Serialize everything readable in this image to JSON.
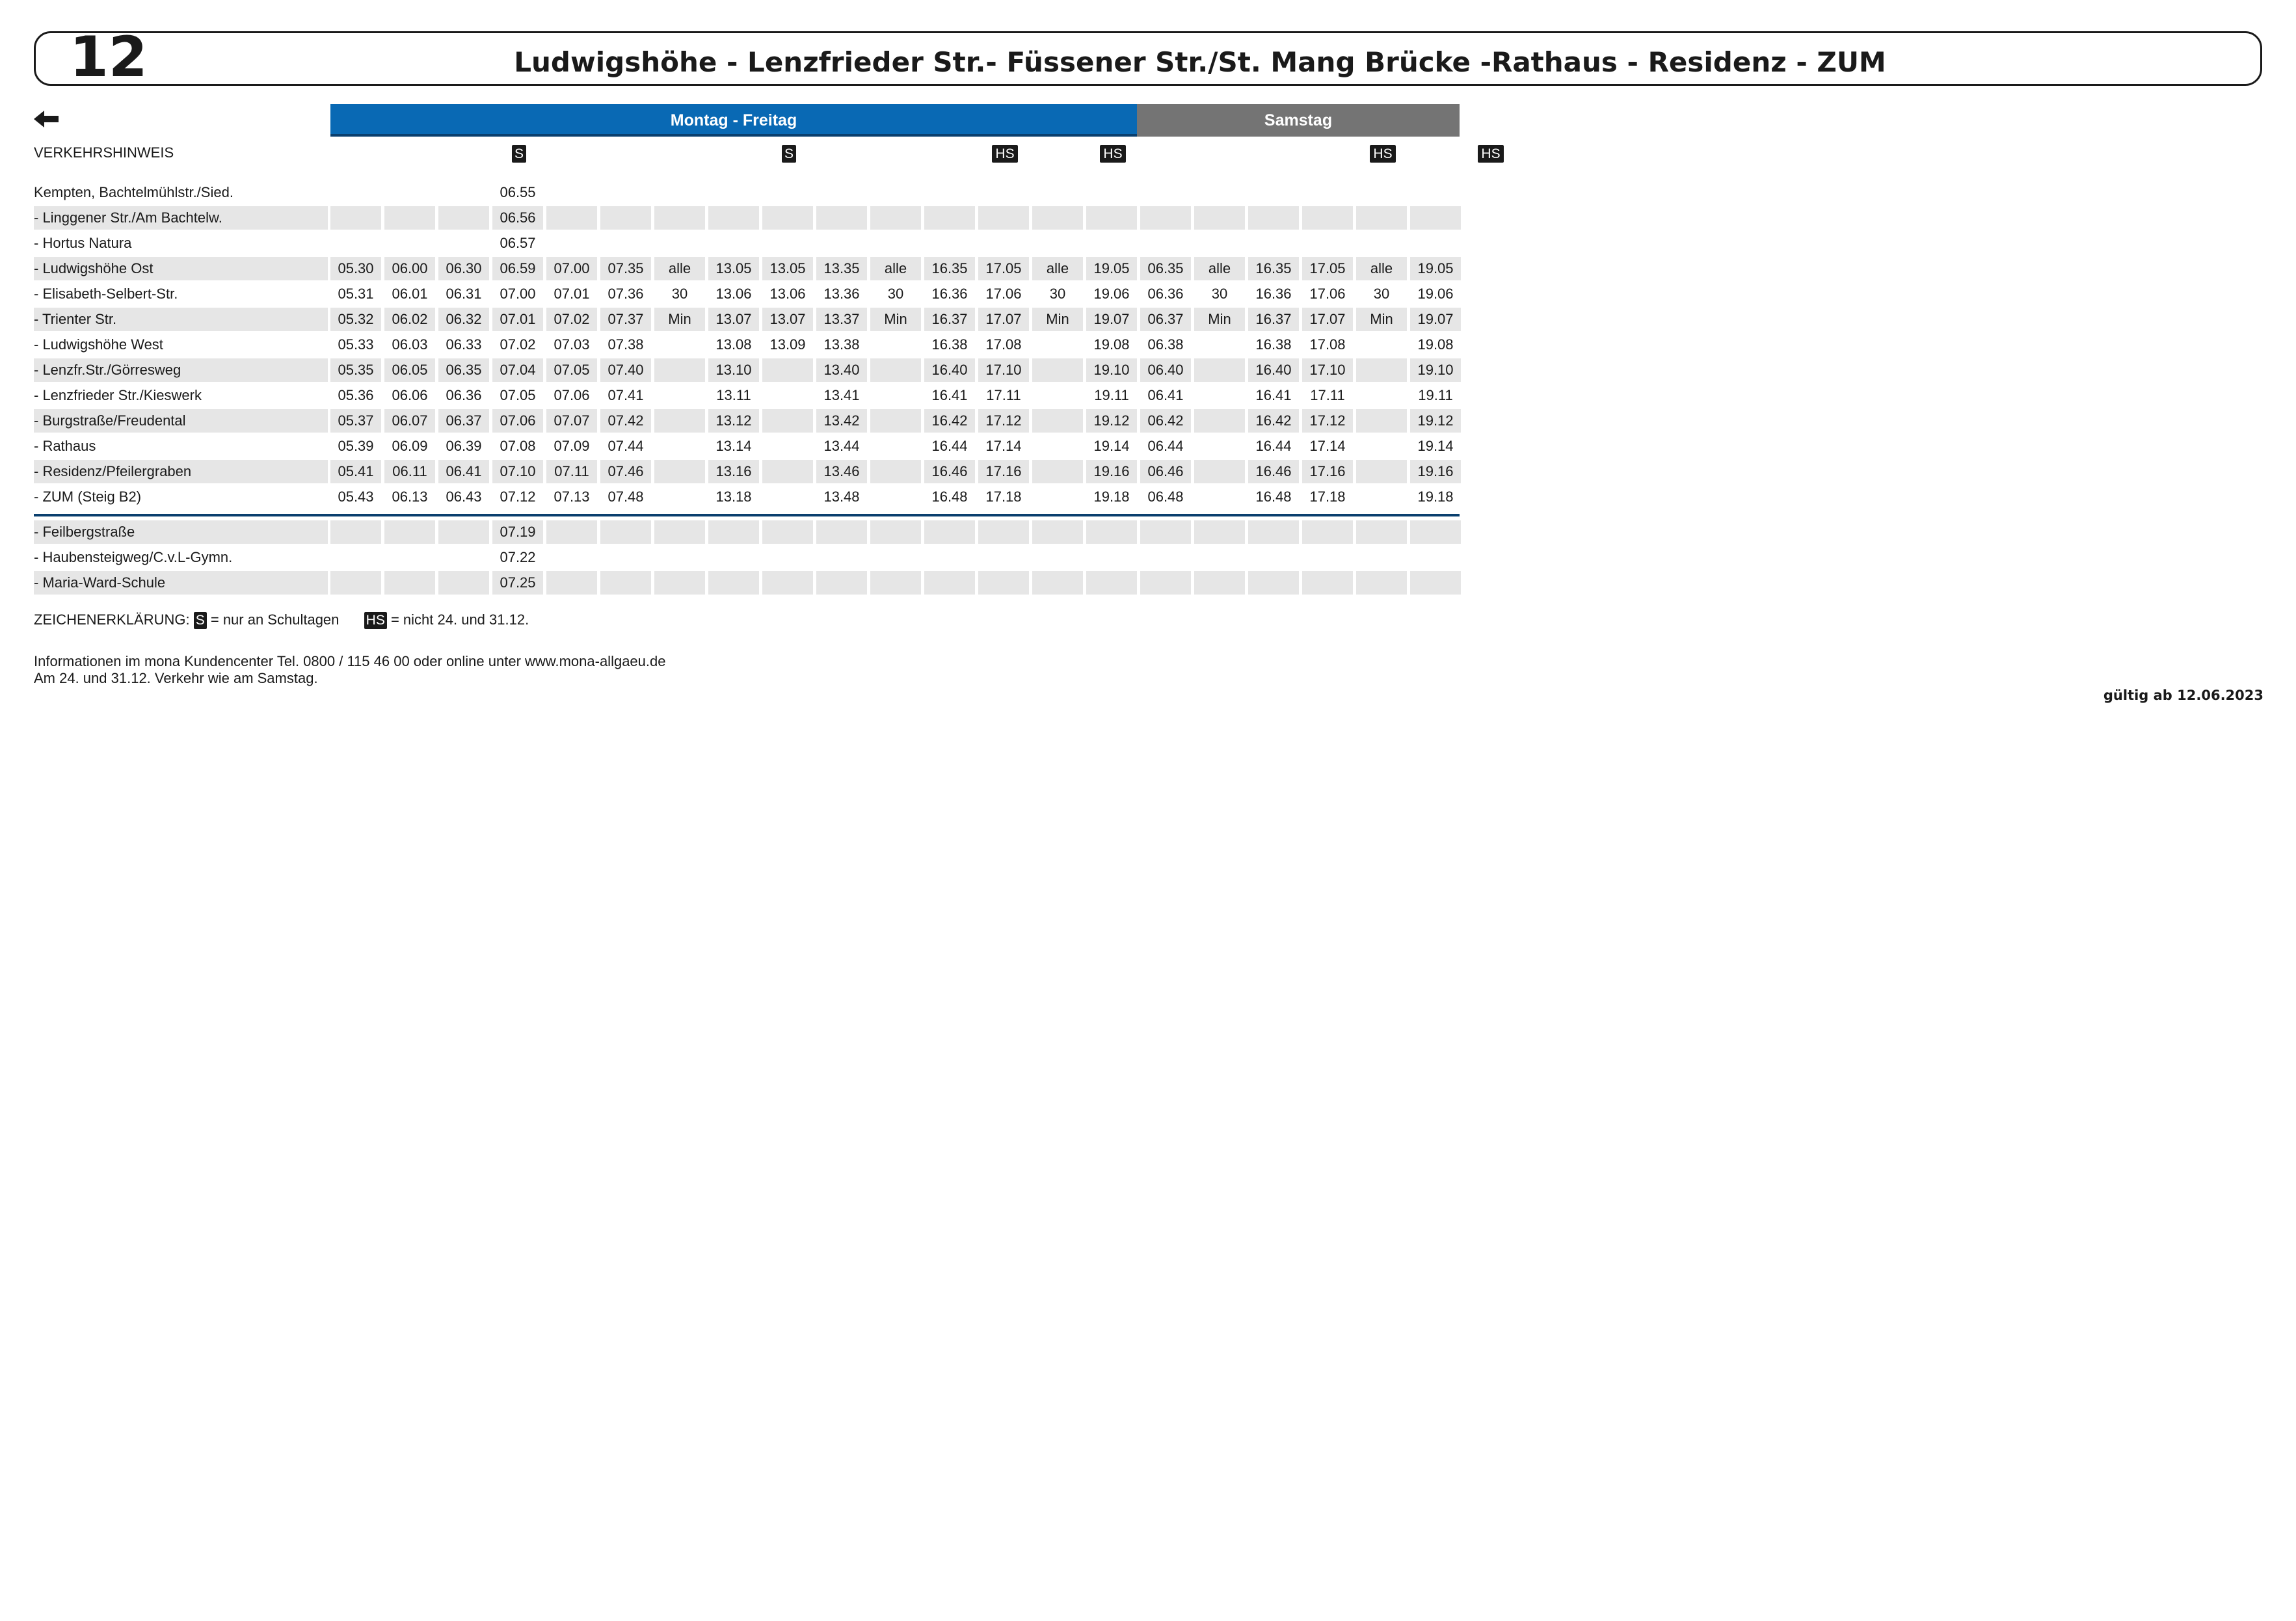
{
  "header": {
    "line_number": "12",
    "route_title": "Ludwigshöhe - Lenzfrieder Str.- Füssener Str./St. Mang Brücke -Rathaus  - Residenz - ZUM"
  },
  "direction_icon": "left-arrow-icon",
  "colors": {
    "weekday_bar": "#0969b4",
    "saturday_bar": "#747474",
    "row_shade": "#e6e6e6",
    "divider": "#0a3f6e"
  },
  "day_groups": {
    "weekday": "Montag - Freitag",
    "saturday": "Samstag"
  },
  "hint_label": "VERKEHRSHINWEIS",
  "hints": [
    "",
    "",
    "",
    "S",
    "",
    "",
    "",
    "",
    "S",
    "",
    "",
    "",
    "HS",
    "",
    "HS",
    "",
    "",
    "",
    "",
    "HS",
    "",
    "HS"
  ],
  "stops": [
    {
      "name": "Kempten, Bachtelmühlstr./Sied.",
      "times": [
        "",
        "",
        "",
        "06.55",
        "",
        "",
        "",
        "",
        "",
        "",
        "",
        "",
        "",
        "",
        "",
        "",
        "",
        "",
        "",
        "",
        "",
        ""
      ]
    },
    {
      "name": "- Linggener Str./Am Bachtelw.",
      "times": [
        "",
        "",
        "",
        "06.56",
        "",
        "",
        "",
        "",
        "",
        "",
        "",
        "",
        "",
        "",
        "",
        "",
        "",
        "",
        "",
        "",
        "",
        ""
      ]
    },
    {
      "name": "- Hortus Natura",
      "times": [
        "",
        "",
        "",
        "06.57",
        "",
        "",
        "",
        "",
        "",
        "",
        "",
        "",
        "",
        "",
        "",
        "",
        "",
        "",
        "",
        "",
        "",
        ""
      ]
    },
    {
      "name": "- Ludwigshöhe Ost",
      "times": [
        "05.30",
        "06.00",
        "06.30",
        "06.59",
        "07.00",
        "07.35",
        "alle",
        "13.05",
        "13.05",
        "13.35",
        "alle",
        "16.35",
        "17.05",
        "alle",
        "19.05",
        "06.35",
        "alle",
        "16.35",
        "17.05",
        "alle",
        "19.05",
        ""
      ]
    },
    {
      "name": "- Elisabeth-Selbert-Str.",
      "times": [
        "05.31",
        "06.01",
        "06.31",
        "07.00",
        "07.01",
        "07.36",
        "30",
        "13.06",
        "13.06",
        "13.36",
        "30",
        "16.36",
        "17.06",
        "30",
        "19.06",
        "06.36",
        "30",
        "16.36",
        "17.06",
        "30",
        "19.06",
        ""
      ]
    },
    {
      "name": "- Trienter Str.",
      "times": [
        "05.32",
        "06.02",
        "06.32",
        "07.01",
        "07.02",
        "07.37",
        "Min",
        "13.07",
        "13.07",
        "13.37",
        "Min",
        "16.37",
        "17.07",
        "Min",
        "19.07",
        "06.37",
        "Min",
        "16.37",
        "17.07",
        "Min",
        "19.07",
        ""
      ]
    },
    {
      "name": "- Ludwigshöhe West",
      "times": [
        "05.33",
        "06.03",
        "06.33",
        "07.02",
        "07.03",
        "07.38",
        "",
        "13.08",
        "13.09",
        "13.38",
        "",
        "16.38",
        "17.08",
        "",
        "19.08",
        "06.38",
        "",
        "16.38",
        "17.08",
        "",
        "19.08",
        ""
      ]
    },
    {
      "name": "- Lenzfr.Str./Görresweg",
      "times": [
        "05.35",
        "06.05",
        "06.35",
        "07.04",
        "07.05",
        "07.40",
        "",
        "13.10",
        "",
        "13.40",
        "",
        "16.40",
        "17.10",
        "",
        "19.10",
        "06.40",
        "",
        "16.40",
        "17.10",
        "",
        "19.10",
        ""
      ]
    },
    {
      "name": "- Lenzfrieder Str./Kieswerk",
      "times": [
        "05.36",
        "06.06",
        "06.36",
        "07.05",
        "07.06",
        "07.41",
        "",
        "13.11",
        "",
        "13.41",
        "",
        "16.41",
        "17.11",
        "",
        "19.11",
        "06.41",
        "",
        "16.41",
        "17.11",
        "",
        "19.11",
        ""
      ]
    },
    {
      "name": "- Burgstraße/Freudental",
      "times": [
        "05.37",
        "06.07",
        "06.37",
        "07.06",
        "07.07",
        "07.42",
        "",
        "13.12",
        "",
        "13.42",
        "",
        "16.42",
        "17.12",
        "",
        "19.12",
        "06.42",
        "",
        "16.42",
        "17.12",
        "",
        "19.12",
        ""
      ]
    },
    {
      "name": "- Rathaus",
      "times": [
        "05.39",
        "06.09",
        "06.39",
        "07.08",
        "07.09",
        "07.44",
        "",
        "13.14",
        "",
        "13.44",
        "",
        "16.44",
        "17.14",
        "",
        "19.14",
        "06.44",
        "",
        "16.44",
        "17.14",
        "",
        "19.14",
        ""
      ]
    },
    {
      "name": "- Residenz/Pfeilergraben",
      "times": [
        "05.41",
        "06.11",
        "06.41",
        "07.10",
        "07.11",
        "07.46",
        "",
        "13.16",
        "",
        "13.46",
        "",
        "16.46",
        "17.16",
        "",
        "19.16",
        "06.46",
        "",
        "16.46",
        "17.16",
        "",
        "19.16",
        ""
      ]
    },
    {
      "name": "- ZUM (Steig B2)",
      "times": [
        "05.43",
        "06.13",
        "06.43",
        "07.12",
        "07.13",
        "07.48",
        "",
        "13.18",
        "",
        "13.48",
        "",
        "16.48",
        "17.18",
        "",
        "19.18",
        "06.48",
        "",
        "16.48",
        "17.18",
        "",
        "19.18",
        ""
      ]
    },
    {
      "name": "- Feilbergstraße",
      "times": [
        "",
        "",
        "",
        "07.19",
        "",
        "",
        "",
        "",
        "",
        "",
        "",
        "",
        "",
        "",
        "",
        "",
        "",
        "",
        "",
        "",
        "",
        ""
      ]
    },
    {
      "name": "- Haubensteigweg/C.v.L-Gymn.",
      "times": [
        "",
        "",
        "",
        "07.22",
        "",
        "",
        "",
        "",
        "",
        "",
        "",
        "",
        "",
        "",
        "",
        "",
        "",
        "",
        "",
        "",
        "",
        ""
      ]
    },
    {
      "name": "- Maria-Ward-Schule",
      "times": [
        "",
        "",
        "",
        "07.25",
        "",
        "",
        "",
        "",
        "",
        "",
        "",
        "",
        "",
        "",
        "",
        "",
        "",
        "",
        "",
        "",
        "",
        ""
      ]
    }
  ],
  "legend": {
    "prefix": "ZEICHENERKLÄRUNG:",
    "s_badge": "S",
    "s_text": "= nur an Schultagen",
    "hs_badge": "HS",
    "hs_text": "= nicht 24. und 31.12."
  },
  "info_line1": "Informationen im mona Kundencenter Tel. 0800 / 115 46 00 oder online unter www.mona-allgaeu.de",
  "info_line2": "Am 24. und 31.12. Verkehr wie am Samstag.",
  "validity": "gültig ab 12.06.2023"
}
